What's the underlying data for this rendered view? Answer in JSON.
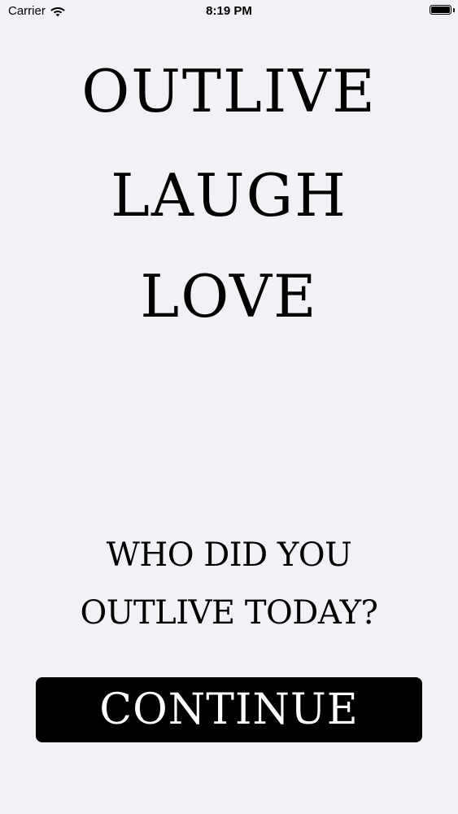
{
  "status_bar": {
    "carrier": "Carrier",
    "time": "8:19 PM",
    "wifi_icon": "wifi-icon",
    "battery_icon": "battery-icon"
  },
  "headline": {
    "line1": "OUTLIVE",
    "line2": "LAUGH",
    "line3": "LOVE"
  },
  "question": {
    "line1": "WHO DID YOU",
    "line2": "OUTLIVE TODAY?"
  },
  "continue_label": "CONTINUE",
  "colors": {
    "background": "#f2f1f6",
    "text": "#000000",
    "button_bg": "#000000",
    "button_text": "#ffffff"
  }
}
